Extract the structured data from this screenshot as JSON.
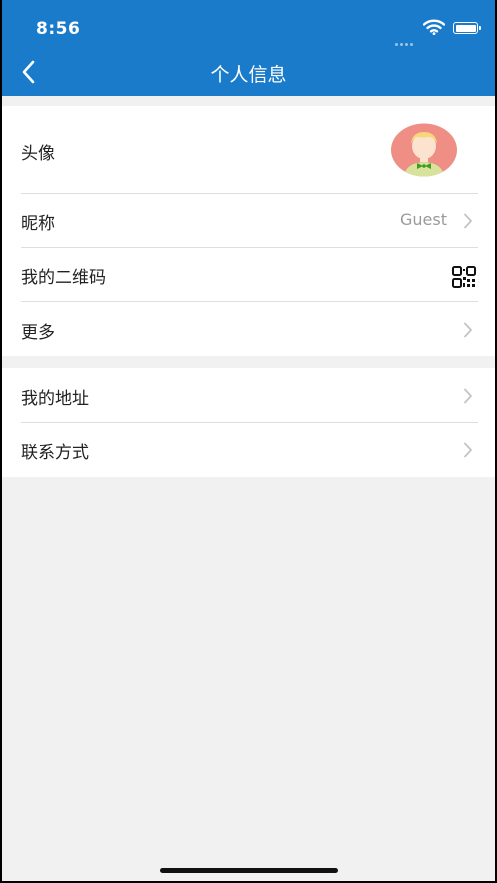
{
  "status_bar": {
    "time": "8:56"
  },
  "nav": {
    "title": "个人信息",
    "back_icon": "chevron-left-icon"
  },
  "colors": {
    "accent": "#1b7bcb",
    "background": "#f2f1f1",
    "avatar_bg": "#ee8e84"
  },
  "group1": {
    "rows": [
      {
        "label": "头像",
        "trailing": "avatar-image"
      },
      {
        "label": "昵称",
        "value": "Guest",
        "trailing": "chevron-right-icon"
      },
      {
        "label": "我的二维码",
        "trailing": "qr-code-icon"
      },
      {
        "label": "更多",
        "trailing": "chevron-right-icon"
      }
    ]
  },
  "group2": {
    "rows": [
      {
        "label": "我的地址",
        "trailing": "chevron-right-icon"
      },
      {
        "label": "联系方式",
        "trailing": "chevron-right-icon"
      }
    ]
  }
}
